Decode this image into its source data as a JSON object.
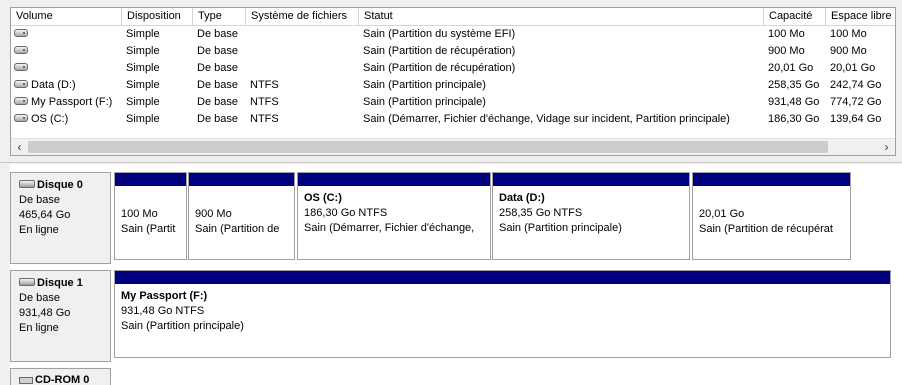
{
  "columns": [
    "Volume",
    "Disposition",
    "Type",
    "Système de fichiers",
    "Statut",
    "Capacité",
    "Espace libre"
  ],
  "volumes": [
    {
      "name": "",
      "layout": "Simple",
      "type": "De base",
      "fs": "",
      "status": "Sain (Partition du système EFI)",
      "capacity": "100 Mo",
      "free": "100 Mo"
    },
    {
      "name": "",
      "layout": "Simple",
      "type": "De base",
      "fs": "",
      "status": "Sain (Partition de récupération)",
      "capacity": "900 Mo",
      "free": "900 Mo"
    },
    {
      "name": "",
      "layout": "Simple",
      "type": "De base",
      "fs": "",
      "status": "Sain (Partition de récupération)",
      "capacity": "20,01 Go",
      "free": "20,01 Go"
    },
    {
      "name": "Data (D:)",
      "layout": "Simple",
      "type": "De base",
      "fs": "NTFS",
      "status": "Sain (Partition principale)",
      "capacity": "258,35 Go",
      "free": "242,74 Go"
    },
    {
      "name": "My Passport (F:)",
      "layout": "Simple",
      "type": "De base",
      "fs": "NTFS",
      "status": "Sain (Partition principale)",
      "capacity": "931,48 Go",
      "free": "774,72 Go"
    },
    {
      "name": "OS (C:)",
      "layout": "Simple",
      "type": "De base",
      "fs": "NTFS",
      "status": "Sain (Démarrer, Fichier d'échange, Vidage sur incident, Partition principale)",
      "capacity": "186,30 Go",
      "free": "139,64 Go"
    }
  ],
  "scroll": {
    "left": "‹",
    "right": "›"
  },
  "disks": [
    {
      "name": "Disque 0",
      "type": "De base",
      "size": "465,64 Go",
      "state": "En ligne",
      "partitions": [
        {
          "title": "",
          "size": "100 Mo",
          "status": "Sain (Partit"
        },
        {
          "title": "",
          "size": "900 Mo",
          "status": "Sain (Partition de"
        },
        {
          "title": "OS  (C:)",
          "size": "186,30 Go NTFS",
          "status": "Sain (Démarrer, Fichier d'échange,"
        },
        {
          "title": "Data  (D:)",
          "size": "258,35 Go NTFS",
          "status": "Sain (Partition principale)"
        },
        {
          "title": "",
          "size": "20,01 Go",
          "status": "Sain (Partition de récupérat"
        }
      ]
    },
    {
      "name": "Disque 1",
      "type": "De base",
      "size": "931,48 Go",
      "state": "En ligne",
      "partitions": [
        {
          "title": "My Passport  (F:)",
          "size": "931,48 Go NTFS",
          "status": "Sain (Partition principale)"
        }
      ]
    }
  ],
  "cdrom": {
    "name": "CD-ROM 0"
  },
  "colors": {
    "partition_bar": "#000080",
    "panel_bg": "#f0f0f0"
  }
}
